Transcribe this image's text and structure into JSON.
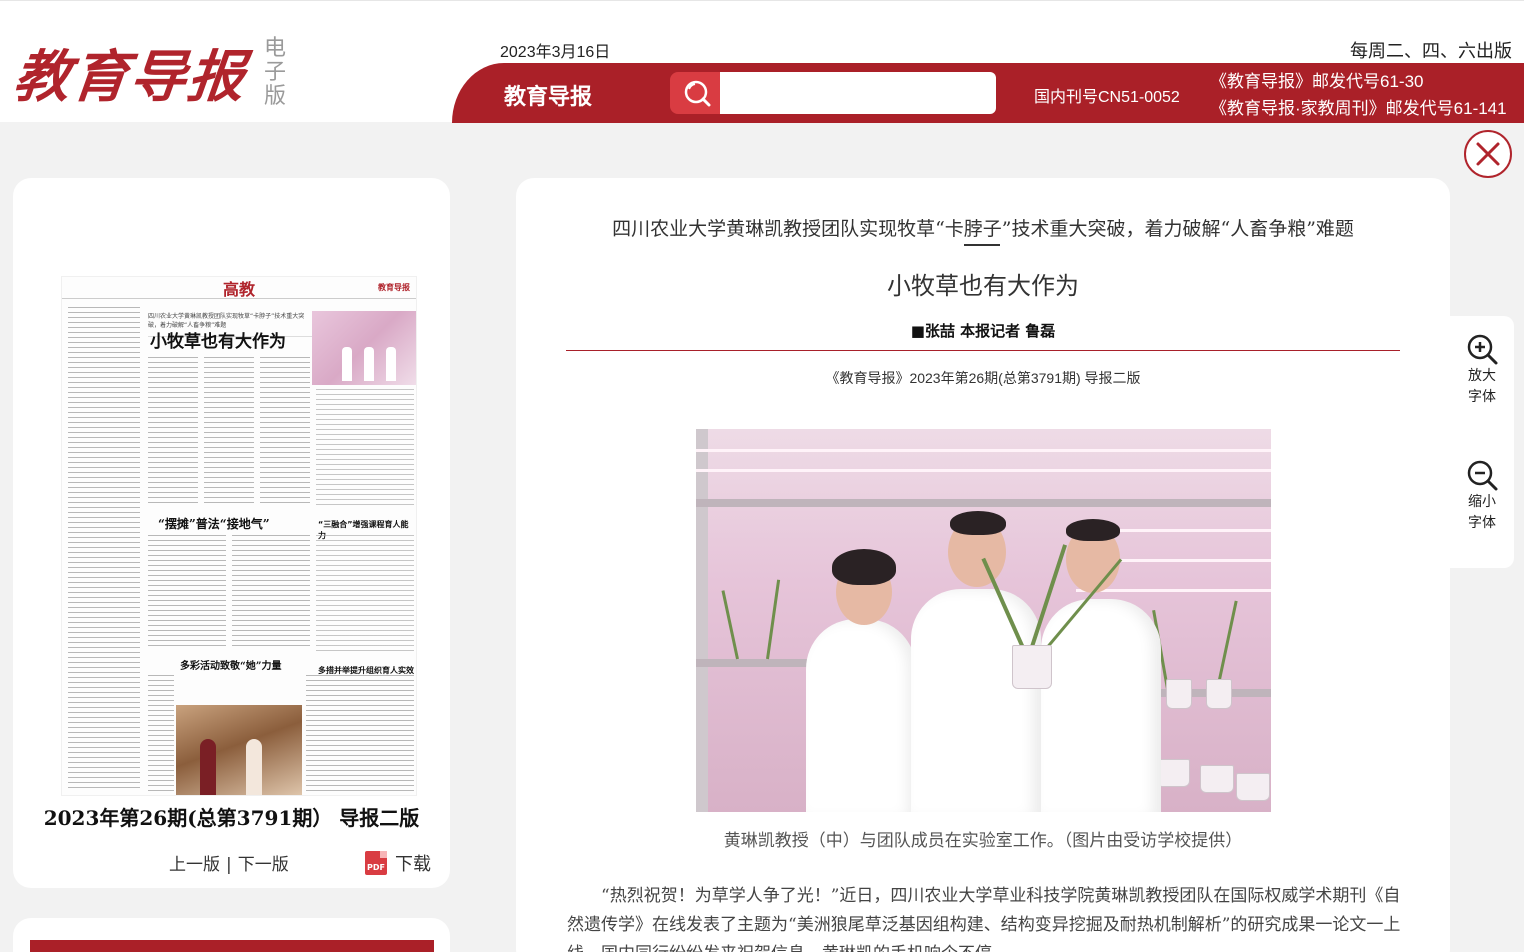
{
  "header": {
    "logo_main": "教育导报",
    "logo_sub": "电子版",
    "date": "2023年3月16日",
    "schedule": "每周二、四、六出版",
    "bar_title": "教育导报",
    "search_placeholder": "",
    "issn": "国内刊号CN51-0052",
    "postal_1": "《教育导报》邮发代号61-30",
    "postal_2": "《教育导报·家教周刊》邮发代号61-141"
  },
  "left_panel": {
    "thumbnail": {
      "section": "高教",
      "masthead": "教育导报",
      "lead": "四川农业大学黄琳凯教授团队实现牧草“卡脖子”技术重大突破，着力破解“人畜争粮”难题",
      "headline": "小牧草也有大作为",
      "sub_1": "“摆摊”普法“接地气”",
      "sub_2": "“三融合”增强课程育人能力",
      "sub_3": "多彩活动致敬“她”力量",
      "sub_4": "多措并举提升组织育人实效"
    },
    "issue_label": "2023年第26期(总第3791期） 导报二版",
    "prev_label": "上一版",
    "separator": "|",
    "next_label": "下一版",
    "pdf_icon_text": "PDF",
    "download_label": "下载"
  },
  "article": {
    "kicker": "四川农业大学黄琳凯教授团队实现牧草“卡脖子”技术重大突破，着力破解“人畜争粮”难题",
    "headline": "小牧草也有大作为",
    "byline": "■张喆  本报记者  鲁磊",
    "source": "《教育导报》2023年第26期(总第3791期) 导报二版",
    "photo_caption": "黄琳凯教授（中）与团队成员在实验室工作。（图片由受访学校提供）",
    "body": "“热烈祝贺！为草学人争了光！”近日，四川农业大学草业科技学院黄琳凯教授团队在国际权威学术期刊《自然遗传学》在线发表了主题为“美洲狼尾草泛基因组构建、结构变异挖掘及耐热机制解析”的研究成果一论文一上线，国内同行纷纷发来祝贺信息，黄琳凯的手机响个不停。"
  },
  "tools": {
    "zoom_in_label": "放大字体",
    "zoom_out_label": "缩小字体"
  },
  "colors": {
    "brand_red": "#aa2028",
    "search_red": "#d93c42",
    "background": "#f2f2f2"
  },
  "icons": [
    "search-icon",
    "close-icon",
    "zoom-in-icon",
    "zoom-out-icon",
    "pdf-icon"
  ]
}
